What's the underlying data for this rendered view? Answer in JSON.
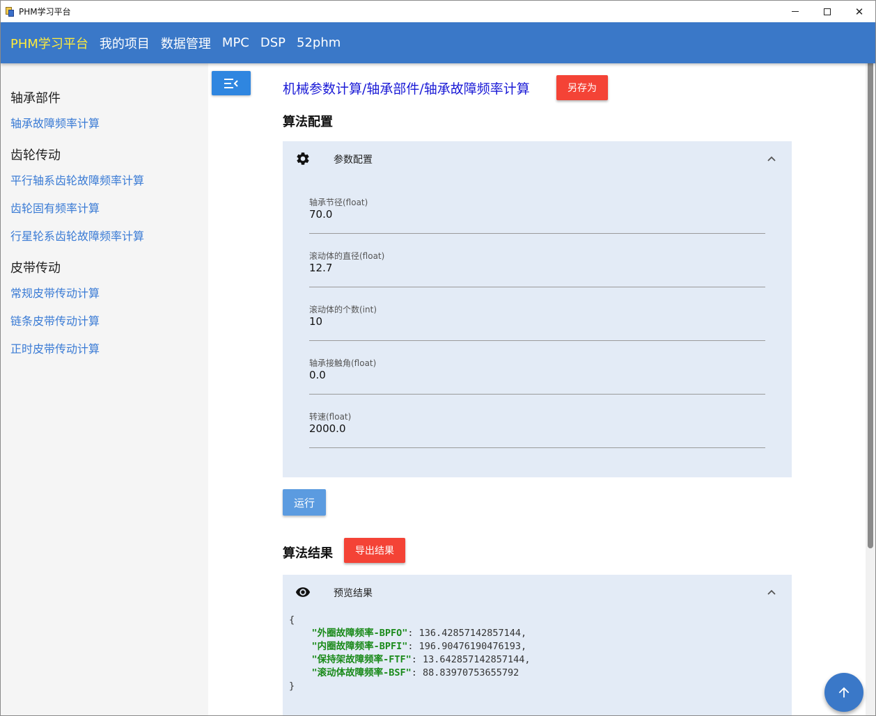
{
  "window": {
    "title": "PHM学习平台",
    "controls": {
      "minimize": "minimize-icon",
      "maximize": "maximize-icon",
      "close": "✕"
    }
  },
  "appbar": {
    "brand": "PHM学习平台",
    "nav": [
      "我的项目",
      "数据管理",
      "MPC",
      "DSP",
      "52phm"
    ],
    "colors": {
      "background": "#3a78c8",
      "brand": "#ffeb3b"
    }
  },
  "sidebar": {
    "groups": [
      {
        "title": "轴承部件",
        "items": [
          "轴承故障频率计算"
        ]
      },
      {
        "title": "齿轮传动",
        "items": [
          "平行轴系齿轮故障频率计算",
          "齿轮固有频率计算",
          "行星轮系齿轮故障频率计算"
        ]
      },
      {
        "title": "皮带传动",
        "items": [
          "常规皮带传动计算",
          "链条皮带传动计算",
          "正时皮带传动计算"
        ]
      }
    ]
  },
  "main": {
    "toggle_icon": "menu-collapse-icon",
    "breadcrumb": "机械参数计算/轴承部件/轴承故障频率计算",
    "save_as_label": "另存为",
    "config_title": "算法配置",
    "config_panel": {
      "label": "参数配置",
      "icon": "gear-icon",
      "fields": [
        {
          "label": "轴承节径(float)",
          "value": "70.0"
        },
        {
          "label": "滚动体的直径(float)",
          "value": "12.7"
        },
        {
          "label": "滚动体的个数(int)",
          "value": "10"
        },
        {
          "label": "轴承接触角(float)",
          "value": "0.0"
        },
        {
          "label": "转速(float)",
          "value": "2000.0"
        }
      ]
    },
    "run_label": "运行",
    "result_title": "算法结果",
    "export_label": "导出结果",
    "result_panel": {
      "label": "预览结果",
      "icon": "eye-icon",
      "json_open": "{",
      "json_close": "}",
      "entries": [
        {
          "key": "\"外圈故障频率-BPFO\"",
          "value": ": 136.42857142857144,"
        },
        {
          "key": "\"内圈故障频率-BPFI\"",
          "value": ": 196.90476190476193,"
        },
        {
          "key": "\"保持架故障频率-FTF\"",
          "value": ": 13.642857142857144,"
        },
        {
          "key": "\"滚动体故障频率-BSF\"",
          "value": ": 88.83970753655792"
        }
      ]
    },
    "colors": {
      "accent": "#2f86e0",
      "danger": "#f44336",
      "panel": "#e3ebf6",
      "link": "#3a7bd5"
    }
  },
  "fab_icon": "arrow-up-icon"
}
